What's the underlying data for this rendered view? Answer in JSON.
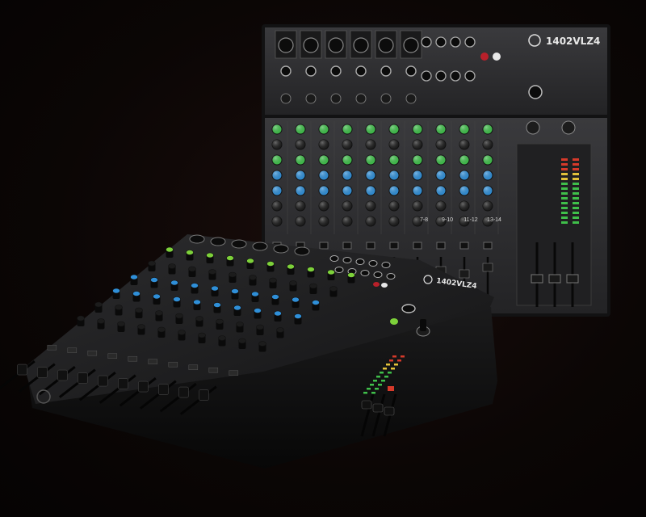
{
  "scene": {
    "background_color": "#0a0606",
    "rear_mixer": {
      "model_text": "1402VLZ4",
      "face_color": "#2a2a2c",
      "knob_colors": [
        "#3fbf4a",
        "#2f8fd8",
        "#1c1c1c"
      ],
      "bus_labels": [
        "7-8",
        "9-10",
        "11-12",
        "13-14"
      ]
    },
    "front_mixer": {
      "model_text": "1402VLZ4",
      "face_color": "#1e1e20",
      "knob_colors": [
        "#7dd13a",
        "#2f8fd8",
        "#1c1c1c"
      ]
    }
  }
}
